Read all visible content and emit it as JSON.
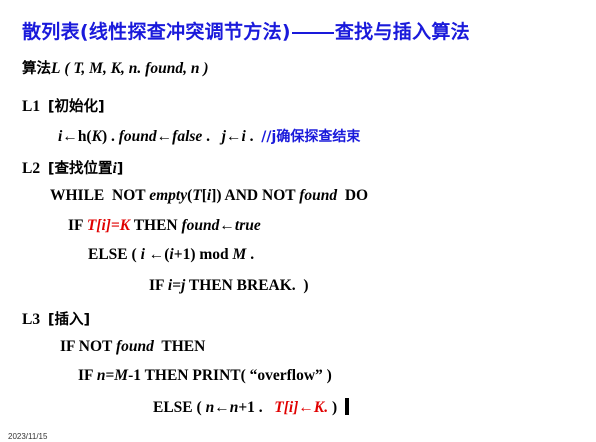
{
  "title": {
    "prefix": "散列表(线性探查冲突调节方法)",
    "suffix": "查找与插入算法"
  },
  "algorithm_header": {
    "label": "算法",
    "name": "L",
    "params": "( T, M, K, n. found, n )"
  },
  "steps": {
    "l1": {
      "label": "L1",
      "title": "[初始化]"
    },
    "l2": {
      "label": "L2",
      "title": "[查找位置",
      "title_var": "i",
      "title_end": "]"
    },
    "l3": {
      "label": "L3",
      "title": "[插入]"
    }
  },
  "lines": {
    "init_a": "i",
    "init_b": "←h(",
    "init_c": "K",
    "init_d": ") . ",
    "init_e": "found",
    "init_f": "←",
    "init_g": "false",
    "init_h": " .   ",
    "init_i": "j",
    "init_j": "←",
    "init_k": "i",
    "init_l": " .  ",
    "comment": "//j确保探查结束",
    "while_a": "WHILE  NOT ",
    "while_b": "empty",
    "while_c": "(",
    "while_d": "T",
    "while_e": "[",
    "while_f": "i",
    "while_g": "]) AND NOT ",
    "while_h": "found",
    "while_i": "  DO",
    "if1_a": "IF ",
    "if1_b": "T[i]=K",
    "if1_c": " THEN ",
    "if1_d": "found",
    "if1_e": "←",
    "if1_f": "true",
    "else1_a": "ELSE ( ",
    "else1_b": "i",
    "else1_c": " ←(",
    "else1_d": "i",
    "else1_e": "+1) mod ",
    "else1_f": "M",
    "else1_g": " .",
    "if2_a": "IF ",
    "if2_b": "i=j",
    "if2_c": " THEN BREAK.  )",
    "if3_a": "IF NOT ",
    "if3_b": "found",
    "if3_c": "  THEN",
    "if4_a": "IF ",
    "if4_b": "n=M",
    "if4_c": "-1 THEN PRINT( “overflow” )",
    "else2_a": "ELSE ( ",
    "else2_b": "n",
    "else2_c": "←",
    "else2_d": "n",
    "else2_e": "+1 .   ",
    "else2_f": "T[i]←K.",
    "else2_g": " )"
  },
  "footer_date": "2023/11/15",
  "colors": {
    "title": "#1a1adb",
    "highlight": "#e00000",
    "comment": "#1a1adb"
  }
}
